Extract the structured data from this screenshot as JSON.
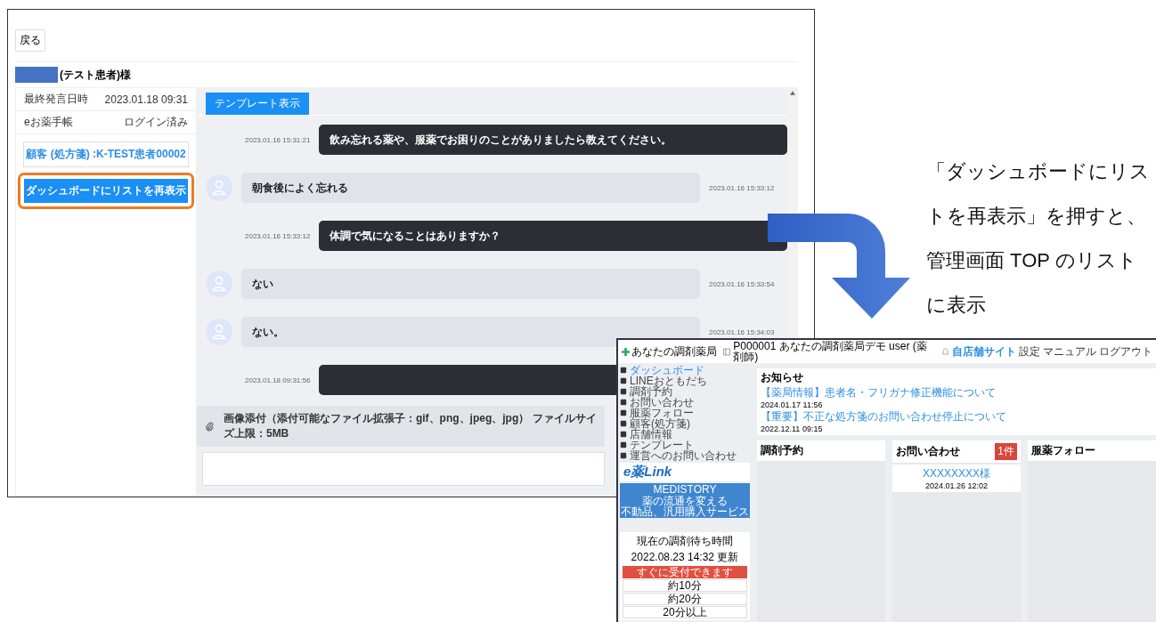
{
  "chat_screen": {
    "back_button": "戻る",
    "patient_name": "(テスト患者)様",
    "info_rows": [
      {
        "label": "最終発言日時",
        "value": "2023.01.18 09:31"
      },
      {
        "label": "eお薬手帳",
        "value": "ログイン済み"
      }
    ],
    "customer_button": "顧客 (処方箋) :K-TEST患者00002",
    "redisplay_button": {
      "label": "ダッシュボードにリストを再表示",
      "highlighted": true
    },
    "template_button": "テンプレート表示",
    "messages": [
      {
        "kind": "staff",
        "time": "2023.01.16 15:31:21",
        "text": "飲み忘れる薬や、服薬でお困りのことがありましたら教えてください。"
      },
      {
        "kind": "patient",
        "time": "2023.01.16 15:33:12",
        "text": "朝食後によく忘れる"
      },
      {
        "kind": "staff",
        "time": "2023.01.16 15:33:12",
        "text": "体調で気になることはありますか？"
      },
      {
        "kind": "patient",
        "time": "2023.01.16 15:33:54",
        "text": "ない"
      },
      {
        "kind": "patient",
        "time": "2023.01.16 15:34:03",
        "text": "ない。"
      },
      {
        "kind": "staff",
        "time": "2023.01.18 09:31:56"
      }
    ],
    "attachment_note": "画像添付（添付可能なファイル拡張子：gif、png、jpeg、jpg） ファイルサイズ上限：5MB"
  },
  "callout": "「ダッシュボードにリストを再表示」を押すと、管理画面 TOP のリストに表示",
  "dashboard_screen": {
    "brand": "あなたの調剤薬局",
    "account": "P000001 あなたの調剤薬局デモ user (薬剤師)",
    "header_links": [
      "自店舗サイト",
      "設定",
      "マニュアル",
      "ログアウト"
    ],
    "nav": [
      {
        "label": "ダッシュボード",
        "selected": true
      },
      {
        "label": "LINEおともだち",
        "selected": false
      },
      {
        "label": "調剤予約",
        "selected": false
      },
      {
        "label": "お問い合わせ",
        "selected": false
      },
      {
        "label": "服薬フォロー",
        "selected": false
      },
      {
        "label": "顧客(処方箋)",
        "selected": false
      },
      {
        "label": "店舗情報",
        "selected": false
      },
      {
        "label": "テンプレート",
        "selected": false
      },
      {
        "label": "運営へのお問い合わせ",
        "selected": false
      }
    ],
    "eyaku_logo": "e薬Link",
    "medistory": {
      "title": "MEDISTORY",
      "lines": [
        "薬の流通を変える",
        "不動品、汎用購入サービス"
      ]
    },
    "wait_panel": {
      "title": "現在の調剤待ち時間",
      "updated": "2022.08.23 14:32 更新",
      "options": [
        {
          "label": "すぐに受付できます",
          "selected": true
        },
        {
          "label": "約10分",
          "selected": false
        },
        {
          "label": "約20分",
          "selected": false
        },
        {
          "label": "20分以上",
          "selected": false
        }
      ]
    },
    "notices": {
      "title": "お知らせ",
      "items": [
        {
          "title": "【薬局情報】患者名・フリガナ修正機能について",
          "date": "2024.01.17 11:56"
        },
        {
          "title": "【重要】不正な処方箋のお問い合わせ停止について",
          "date": "2022.12.11 09:15"
        }
      ]
    },
    "columns": [
      {
        "title": "調剤予約"
      },
      {
        "title": "お問い合わせ",
        "badge": "1件",
        "items": [
          {
            "name": "XXXXXXXX様",
            "date": "2024.01.26 12:02"
          }
        ]
      },
      {
        "title": "服薬フォロー"
      }
    ]
  }
}
